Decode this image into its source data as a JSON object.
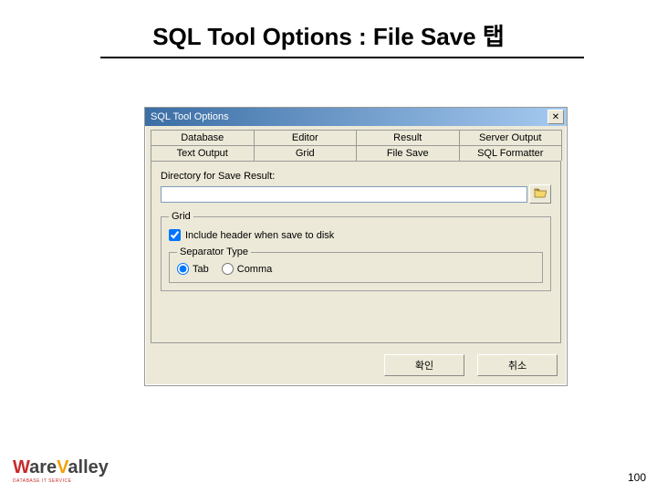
{
  "slide": {
    "title": "SQL Tool Options : File Save 탭",
    "page": "100"
  },
  "logo": {
    "line1_a": "W",
    "line1_b": "are",
    "line1_c": "V",
    "line1_d": "alley",
    "sub": "DATABASE IT SERVICE"
  },
  "dialog": {
    "title": "SQL Tool Options",
    "close": "✕",
    "tabs_row1": [
      "Database",
      "Editor",
      "Result",
      "Server Output"
    ],
    "tabs_row2": [
      "Text Output",
      "Grid",
      "File Save",
      "SQL Formatter"
    ],
    "active_tab_index": 6,
    "panel": {
      "dir_label": "Directory for Save Result:",
      "dir_value": "",
      "grid_group": "Grid",
      "include_header": {
        "label": "Include header when save to disk",
        "checked": true
      },
      "sep_group": "Separator Type",
      "sep_tab": {
        "label": "Tab",
        "selected": true
      },
      "sep_comma": {
        "label": "Comma",
        "selected": false
      }
    },
    "buttons": {
      "ok": "확인",
      "cancel": "취소"
    }
  }
}
